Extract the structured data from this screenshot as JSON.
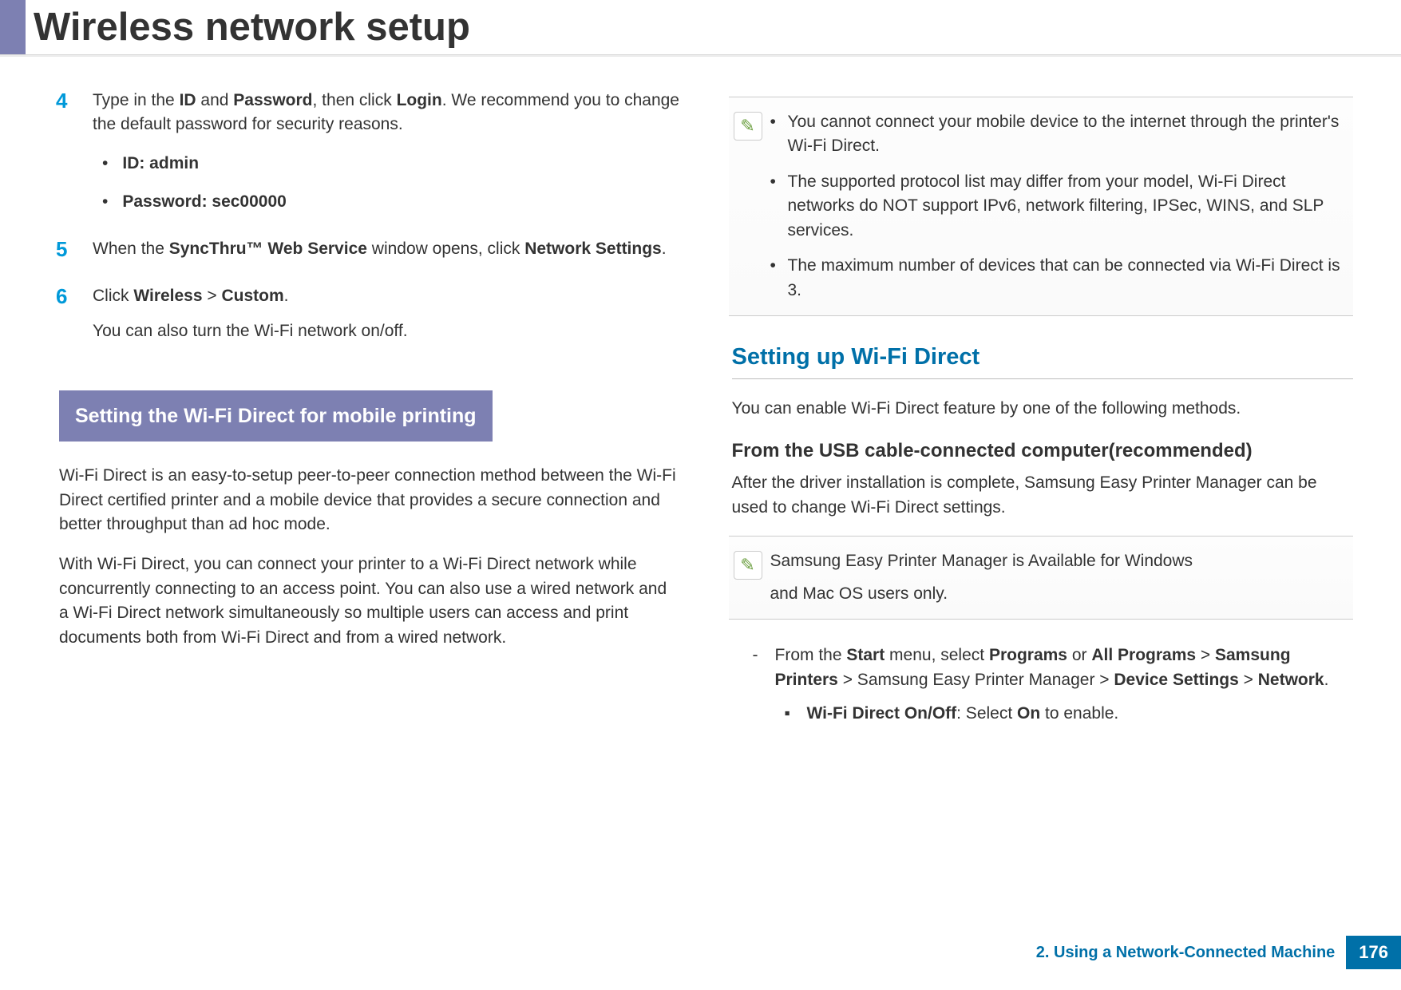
{
  "header": {
    "title": "Wireless network setup"
  },
  "left": {
    "step4": {
      "num": "4",
      "text_parts": [
        "Type in the ",
        "ID",
        " and ",
        "Password",
        ", then click ",
        "Login",
        ". We recommend you to change the default password for security reasons."
      ],
      "bullet1": "ID: admin",
      "bullet2": "Password: sec00000"
    },
    "step5": {
      "num": "5",
      "text_parts": [
        "When the ",
        "SyncThru™ Web Service",
        " window opens, click ",
        "Network Settings",
        "."
      ]
    },
    "step6": {
      "num": "6",
      "text_parts": [
        "Click ",
        "Wireless",
        " > ",
        "Custom",
        "."
      ],
      "extra": "You can also turn the Wi-Fi network on/off."
    },
    "section_header": "Setting the Wi-Fi Direct for mobile printing",
    "para1": "Wi-Fi Direct is an easy-to-setup peer-to-peer connection method between the Wi-Fi Direct certified printer and a mobile device that provides a secure connection and better throughput than ad hoc mode.",
    "para2": "With Wi-Fi Direct, you can connect your printer to a Wi-Fi Direct network while concurrently connecting to an access point. You can also use a wired network and a Wi-Fi Direct network simultaneously so multiple users can access and print documents both from Wi-Fi Direct and from a wired network."
  },
  "right": {
    "note1": {
      "b1": "You cannot connect your mobile device to the internet through the printer's Wi-Fi Direct.",
      "b2": "The supported protocol list may differ from your model, Wi-Fi Direct networks do NOT support IPv6, network filtering, IPSec, WINS, and SLP services.",
      "b3": "The maximum number of devices that can be connected via Wi-Fi Direct is 3."
    },
    "h2": "Setting up Wi-Fi Direct",
    "para3": "You can enable Wi-Fi Direct feature by one of the following methods.",
    "h3": "From the USB cable-connected computer(recommended)",
    "para4": "After the driver installation is complete, Samsung Easy Printer Manager can be used to change Wi-Fi Direct settings.",
    "note2": {
      "line1": "Samsung Easy Printer Manager is Available for Windows",
      "line2": "and Mac OS users only."
    },
    "dash_item_parts": [
      "From the ",
      "Start",
      " menu, select ",
      "Programs",
      " or ",
      "All Programs",
      " > ",
      "Samsung Printers",
      " > Samsung Easy Printer Manager > ",
      "Device Settings",
      " > ",
      "Network",
      "."
    ],
    "square_item_parts": [
      "Wi-Fi Direct On/Off",
      ": Select ",
      "On",
      " to enable."
    ]
  },
  "footer": {
    "chapter": "2.  Using a Network-Connected Machine",
    "page": "176"
  }
}
